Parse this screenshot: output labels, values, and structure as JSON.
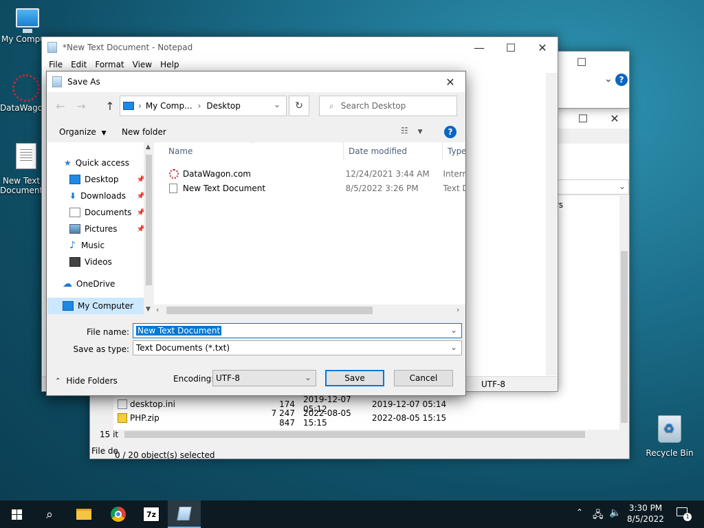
{
  "desktop": {
    "icons": [
      {
        "label": "My Computer"
      },
      {
        "label": "DataWagon.com"
      },
      {
        "label": "New Text Document"
      },
      {
        "label": "Recycle Bin"
      }
    ]
  },
  "notepad": {
    "title": "*New Text Document - Notepad",
    "menu": [
      "File",
      "Edit",
      "Format",
      "View",
      "Help"
    ],
    "status_encoding": "UTF-8"
  },
  "explorer_back": {
    "column_fragment": "rs",
    "rows": [
      {
        "name": "desktop.ini",
        "size": "174",
        "modified": "2019-12-07 05:12",
        "created": "2019-12-07 05:14"
      },
      {
        "name": "PHP.zip",
        "size": "7 247 847",
        "modified": "2022-08-05 15:15",
        "created": "2022-08-05 15:15"
      }
    ],
    "items_fragment": "15 it",
    "status_fragment": "File de",
    "selection_status": "0 / 20 object(s) selected"
  },
  "saveas": {
    "title": "Save As",
    "breadcrumb": [
      "My Comp...",
      "Desktop"
    ],
    "search_placeholder": "Search Desktop",
    "organize": "Organize",
    "new_folder": "New folder",
    "help": "?",
    "nav": [
      {
        "label": "Quick access",
        "icon": "star-icon",
        "pinned": false
      },
      {
        "label": "Desktop",
        "icon": "desktop-icon",
        "pinned": true
      },
      {
        "label": "Downloads",
        "icon": "download-icon",
        "pinned": true
      },
      {
        "label": "Documents",
        "icon": "documents-icon",
        "pinned": true
      },
      {
        "label": "Pictures",
        "icon": "pictures-icon",
        "pinned": true
      },
      {
        "label": "Music",
        "icon": "music-icon",
        "pinned": false
      },
      {
        "label": "Videos",
        "icon": "videos-icon",
        "pinned": false
      },
      {
        "label": "OneDrive",
        "icon": "cloud-icon",
        "pinned": false
      },
      {
        "label": "My Computer",
        "icon": "computer-icon",
        "pinned": false
      }
    ],
    "columns": {
      "name": "Name",
      "date": "Date modified",
      "type": "Type"
    },
    "files": [
      {
        "name": "DataWagon.com",
        "date": "12/24/2021 3:44 AM",
        "type": "Intern"
      },
      {
        "name": "New Text Document",
        "date": "8/5/2022 3:26 PM",
        "type": "Text D"
      }
    ],
    "file_name_label": "File name:",
    "file_name_value": "New Text Document",
    "save_type_label": "Save as type:",
    "save_type_value": "Text Documents (*.txt)",
    "hide_folders": "Hide Folders",
    "encoding_label": "Encoding:",
    "encoding_value": "UTF-8",
    "save": "Save",
    "cancel": "Cancel"
  },
  "taskbar": {
    "time": "3:30 PM",
    "date": "8/5/2022",
    "notification_count": "1"
  },
  "colors": {
    "accent": "#0078d7",
    "selection": "#0078d7",
    "nav_selected": "#cce8ff"
  }
}
